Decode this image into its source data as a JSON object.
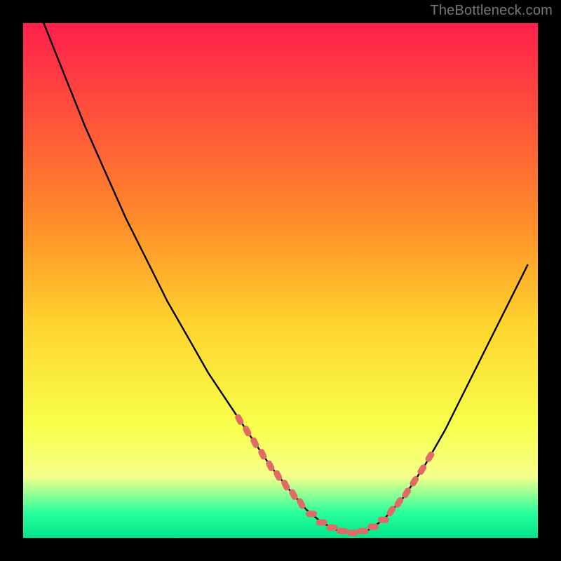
{
  "watermark": "TheBottleneck.com",
  "colors": {
    "bg_black": "#000000",
    "grad_top": "#ff1f4b",
    "grad_mid1": "#ff8a2a",
    "grad_mid2": "#ffd22e",
    "grad_mid3": "#f7ff4a",
    "grad_bottom_yellow": "#f7ff8a",
    "grad_green": "#2bff9c",
    "grad_green2": "#00e58a",
    "curve": "#000000",
    "dots": "#e06a66"
  },
  "chart_data": {
    "type": "line",
    "title": "",
    "xlabel": "",
    "ylabel": "",
    "xlim": [
      0,
      100
    ],
    "ylim": [
      0,
      100
    ],
    "series": [
      {
        "name": "bottleneck-curve",
        "x": [
          4,
          8,
          12,
          16,
          20,
          24,
          28,
          32,
          36,
          40,
          44,
          48,
          52,
          55,
          58,
          61,
          64,
          67,
          70,
          74,
          78,
          82,
          86,
          90,
          94,
          98
        ],
        "y": [
          100,
          90,
          80,
          71,
          62,
          54,
          46,
          39,
          32,
          26,
          20,
          14,
          9,
          5.5,
          3,
          1.5,
          1,
          1.5,
          3.5,
          8,
          14,
          21,
          29,
          37,
          45,
          53
        ]
      }
    ],
    "highlight_points": {
      "name": "fit-range-dots",
      "x_left": [
        42,
        43.5,
        45,
        46.5,
        48,
        49.5,
        51,
        52.5,
        54
      ],
      "x_bottom": [
        56,
        58,
        60,
        62,
        64,
        66,
        68,
        70
      ],
      "x_right": [
        71.5,
        73,
        74.5,
        76,
        77.5,
        79
      ]
    }
  }
}
